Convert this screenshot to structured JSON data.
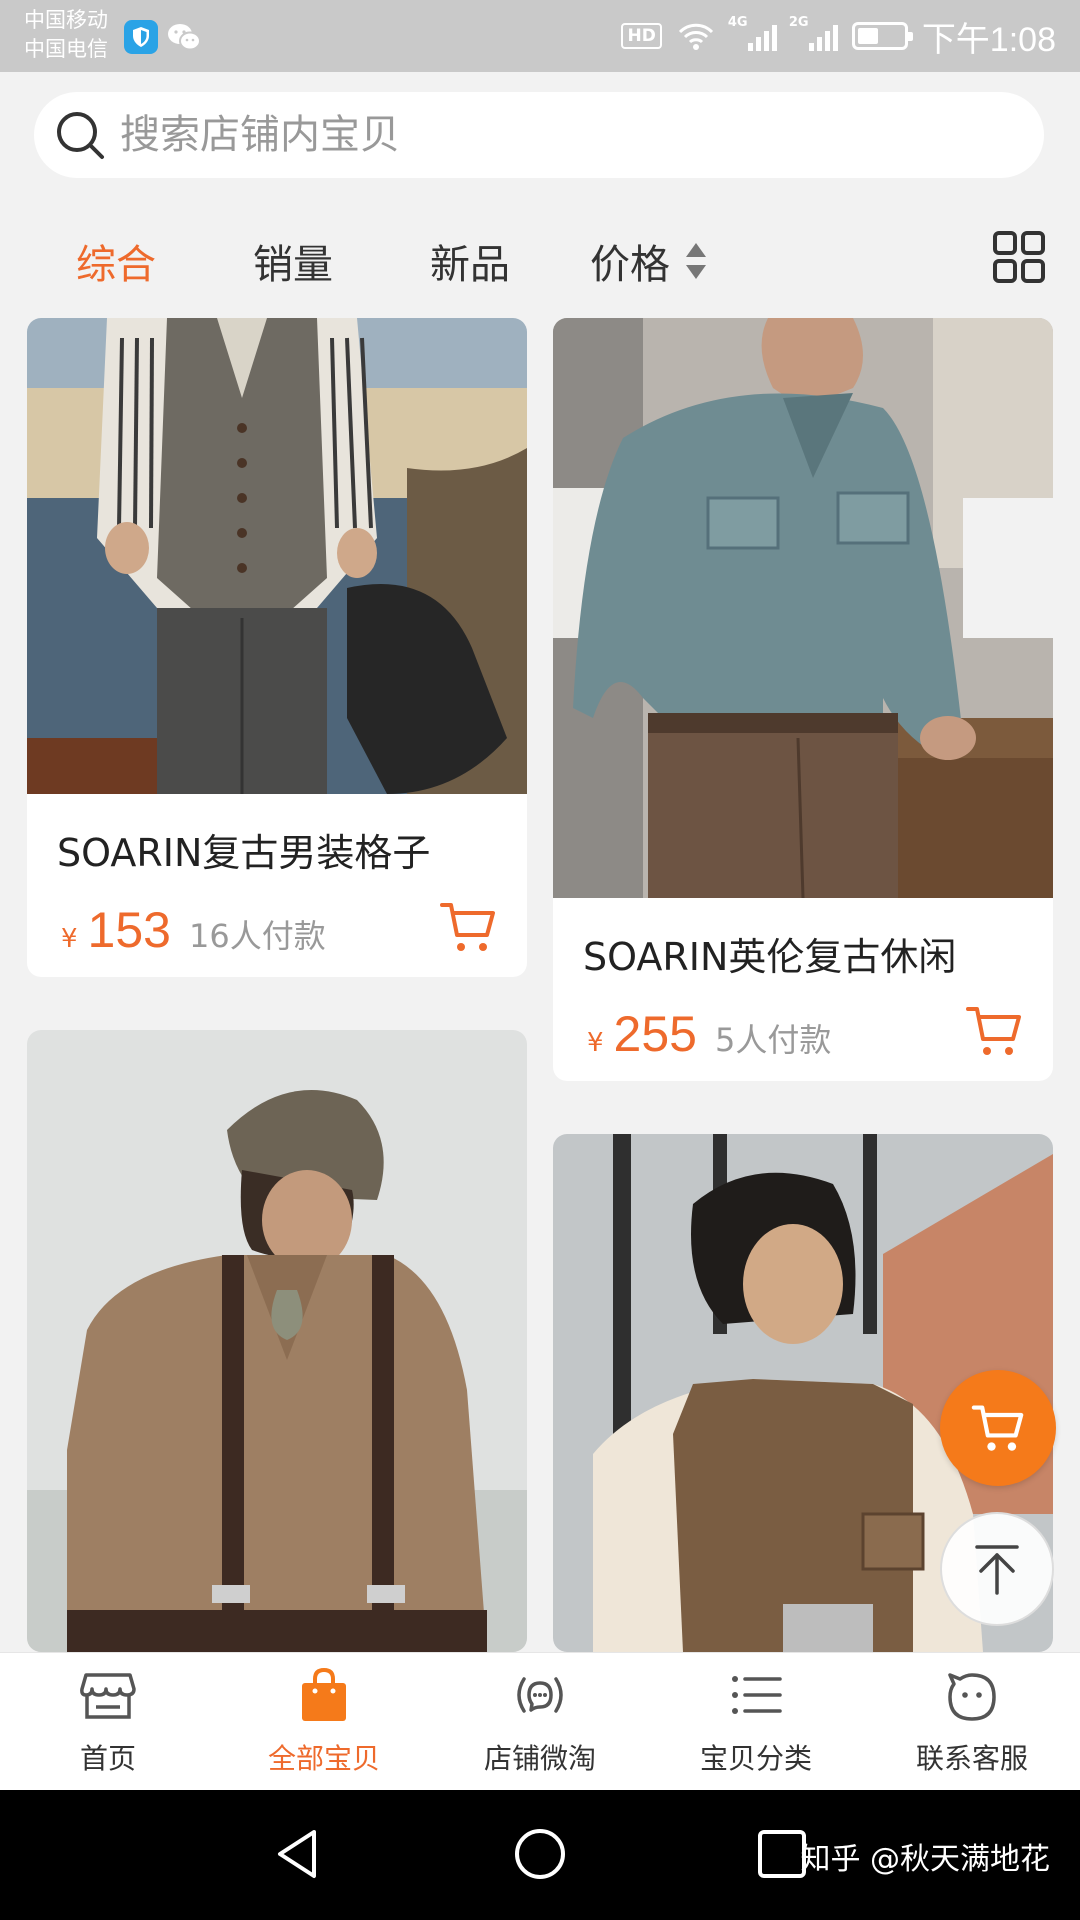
{
  "status_bar": {
    "carrier_1": "中国移动",
    "carrier_2": "中国电信",
    "hd": "HD",
    "network_1": "4G",
    "network_2": "2G",
    "time": "下午1:08",
    "battery_level": 0.45
  },
  "search": {
    "placeholder": "搜索店铺内宝贝"
  },
  "sort_tabs": [
    {
      "label": "综合",
      "active": true
    },
    {
      "label": "销量",
      "active": false
    },
    {
      "label": "新品",
      "active": false
    },
    {
      "label": "价格",
      "active": false
    }
  ],
  "products": [
    {
      "title": "SOARIN复古男装格子",
      "currency": "¥",
      "price": "153",
      "sales": "16人付款"
    },
    {
      "title": "SOARIN英伦复古休闲",
      "currency": "¥",
      "price": "255",
      "sales": "5人付款"
    },
    {
      "title": "",
      "currency": "",
      "price": "",
      "sales": ""
    },
    {
      "title": "",
      "currency": "",
      "price": "",
      "sales": ""
    }
  ],
  "bottom_nav": [
    {
      "label": "首页",
      "icon": "store-icon",
      "active": false
    },
    {
      "label": "全部宝贝",
      "icon": "shopping-bag-icon",
      "active": true
    },
    {
      "label": "店铺微淘",
      "icon": "broadcast-icon",
      "active": false
    },
    {
      "label": "宝贝分类",
      "icon": "list-icon",
      "active": false
    },
    {
      "label": "联系客服",
      "icon": "chat-face-icon",
      "active": false
    }
  ],
  "watermark": "知乎 @秋天满地花",
  "colors": {
    "accent": "#ee6a2c",
    "fab": "#f57a1a",
    "status_bar": "#c9c9c9"
  }
}
